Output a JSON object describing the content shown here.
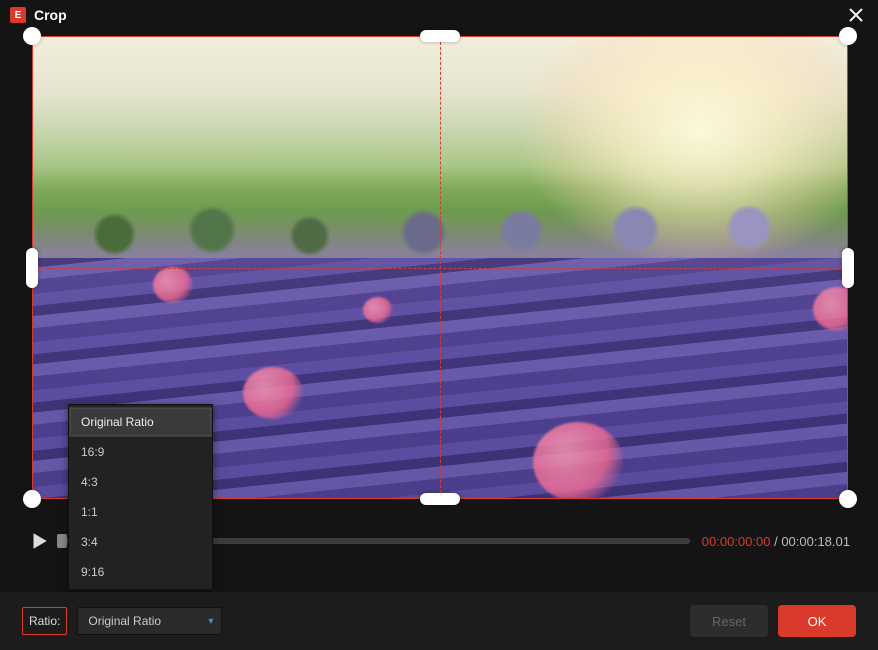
{
  "window": {
    "title": "Crop",
    "app_icon_letter": "E"
  },
  "playbar": {
    "current_time": "00:00:00:00",
    "separator": " / ",
    "duration": "00:00:18.01"
  },
  "ratio": {
    "label": "Ratio:",
    "selected": "Original Ratio",
    "options": [
      "Original Ratio",
      "16:9",
      "4:3",
      "1:1",
      "3:4",
      "9:16"
    ]
  },
  "buttons": {
    "reset": "Reset",
    "ok": "OK"
  },
  "colors": {
    "accent": "#d93a2b"
  }
}
